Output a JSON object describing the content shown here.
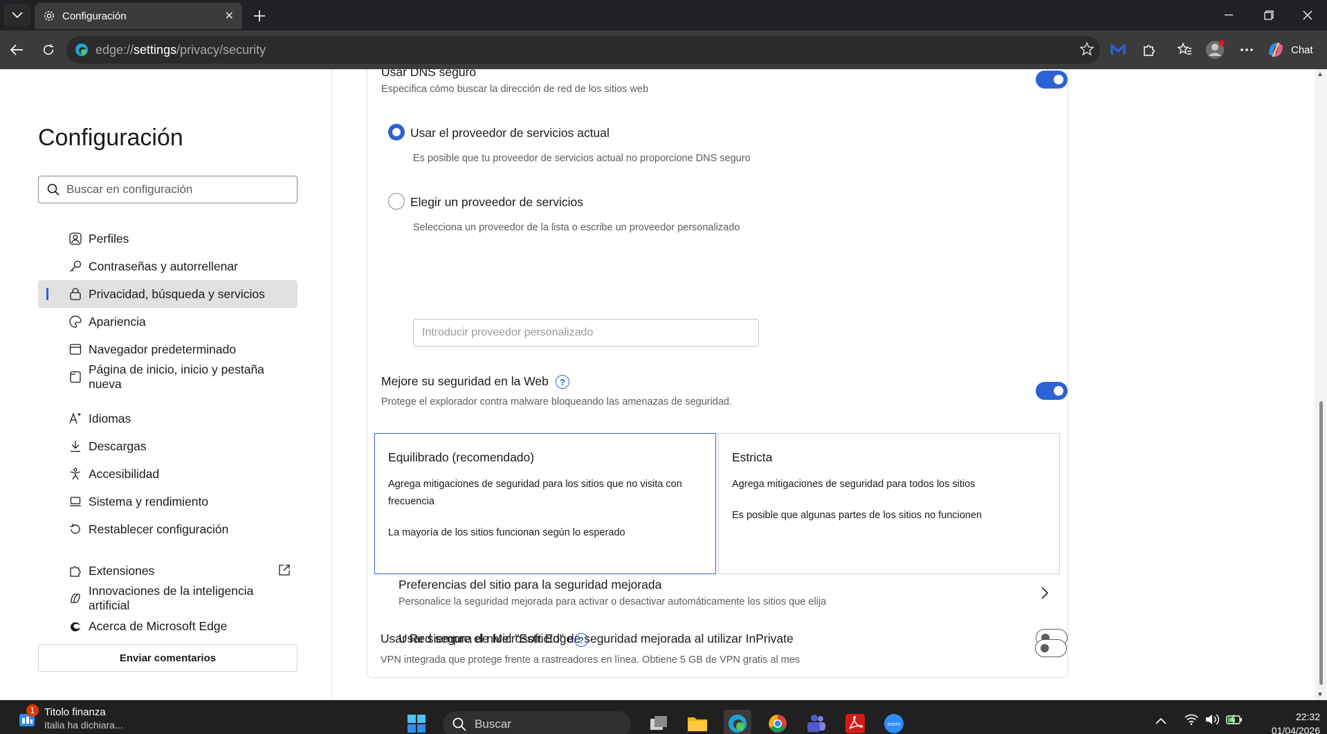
{
  "browser": {
    "tab_title": "Configuración",
    "url_prefix": "edge://",
    "url_main": "settings",
    "url_rest": "/privacy/security",
    "chat_label": "Chat"
  },
  "sidebar": {
    "title": "Configuración",
    "search_placeholder": "Buscar en configuración",
    "items": [
      {
        "label": "Perfiles",
        "icon": "profile-icon"
      },
      {
        "label": "Contraseñas y autorrellenar",
        "icon": "key-icon"
      },
      {
        "label": "Privacidad, búsqueda y servicios",
        "icon": "lock-icon",
        "active": true
      },
      {
        "label": "Apariencia",
        "icon": "palette-icon"
      },
      {
        "label": "Navegador predeterminado",
        "icon": "browser-icon"
      },
      {
        "label": "Página de inicio, inicio y pestaña nueva",
        "icon": "home-tab-icon"
      },
      {
        "label": "Idiomas",
        "icon": "languages-icon"
      },
      {
        "label": "Descargas",
        "icon": "download-icon"
      },
      {
        "label": "Accesibilidad",
        "icon": "accessibility-icon"
      },
      {
        "label": "Sistema y rendimiento",
        "icon": "laptop-icon"
      },
      {
        "label": "Restablecer configuración",
        "icon": "reset-icon"
      },
      {
        "label": "Extensiones",
        "icon": "puzzle-icon"
      },
      {
        "label": "Innovaciones de la inteligencia artificial",
        "icon": "ai-icon"
      },
      {
        "label": "Acerca de Microsoft Edge",
        "icon": "edge-icon"
      }
    ],
    "feedback_label": "Enviar comentarios"
  },
  "content": {
    "dns": {
      "title": "Usar DNS seguro",
      "subtitle": "Especifica cómo buscar la dirección de red de los sitios web",
      "enabled": true,
      "option1_label": "Usar el proveedor de servicios actual",
      "option1_desc": "Es posible que tu proveedor de servicios actual no proporcione DNS seguro",
      "option2_label": "Elegir un proveedor de servicios",
      "option2_desc": "Selecciona un proveedor de la lista o escribe un proveedor personalizado",
      "custom_placeholder": "Introducir proveedor personalizado"
    },
    "web_security": {
      "title": "Mejore su seguridad en la Web",
      "subtitle": "Protege el explorador contra malware bloqueando las amenazas de seguridad.",
      "enabled": true
    },
    "balanced": {
      "title": "Equilibrado (recomendado)",
      "desc": "Agrega mitigaciones de seguridad para los sitios que no visita con frecuencia",
      "desc2": "La mayoría de los sitios funcionan según lo esperado"
    },
    "strict": {
      "title": "Estricta",
      "desc": "Agrega mitigaciones de seguridad para todos los sitios",
      "desc2": "Es posible que algunas partes de los sitios no funcionen"
    },
    "site_prefs": {
      "title": "Preferencias del sitio para la seguridad mejorada",
      "subtitle": "Personalice la seguridad mejorada para activar o desactivar automáticamente los sitios que elija"
    },
    "inprivate": {
      "title": "Usar siempre el nivel \"Estricto\" de seguridad mejorada al utilizar InPrivate",
      "enabled": false
    },
    "secure_network": {
      "title": "Usar Red segura de Microsoft Edge",
      "subtitle": "VPN integrada que protege frente a rastreadores en línea. Obtiene 5 GB de VPN gratis al mes",
      "enabled": false
    }
  },
  "taskbar": {
    "news_title": "Titolo finanza",
    "news_sub": "Italia ha dichiara...",
    "news_badge": "1",
    "search_placeholder": "Buscar",
    "time": "22:32",
    "date": "01/04/2026"
  },
  "colors": {
    "accent": "#2b62d6",
    "chrome_dark": "#202124",
    "toolbar": "#3b3b3b"
  }
}
